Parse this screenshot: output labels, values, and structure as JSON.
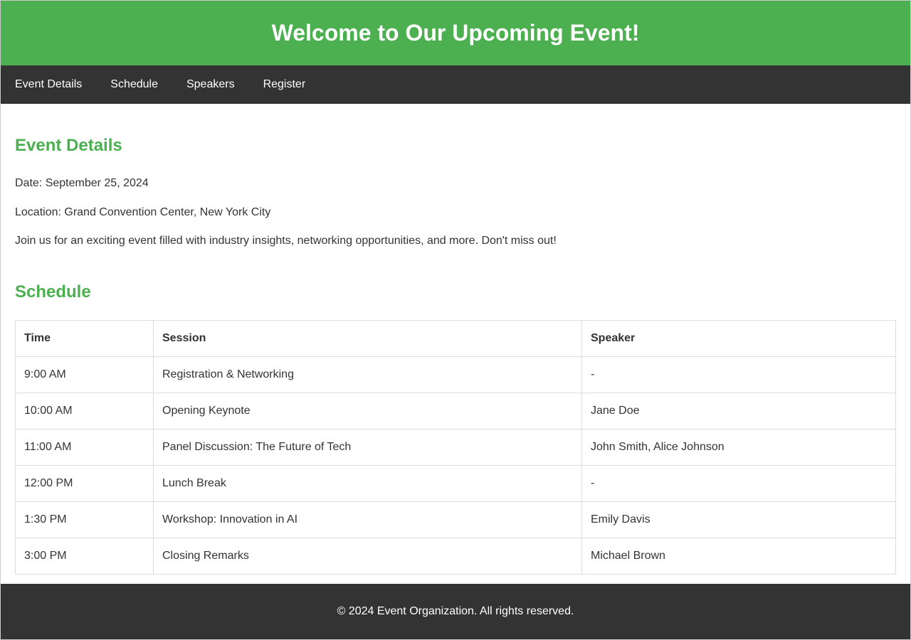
{
  "header": {
    "title": "Welcome to Our Upcoming Event!"
  },
  "nav": {
    "items": [
      {
        "label": "Event Details"
      },
      {
        "label": "Schedule"
      },
      {
        "label": "Speakers"
      },
      {
        "label": "Register"
      }
    ]
  },
  "event_details": {
    "title": "Event Details",
    "date": "Date: September 25, 2024",
    "location": "Location: Grand Convention Center, New York City",
    "description": "Join us for an exciting event filled with industry insights, networking opportunities, and more. Don't miss out!"
  },
  "schedule": {
    "title": "Schedule",
    "columns": [
      "Time",
      "Session",
      "Speaker"
    ],
    "rows": [
      [
        "9:00 AM",
        "Registration & Networking",
        "-"
      ],
      [
        "10:00 AM",
        "Opening Keynote",
        "Jane Doe"
      ],
      [
        "11:00 AM",
        "Panel Discussion: The Future of Tech",
        "John Smith, Alice Johnson"
      ],
      [
        "12:00 PM",
        "Lunch Break",
        "-"
      ],
      [
        "1:30 PM",
        "Workshop: Innovation in AI",
        "Emily Davis"
      ],
      [
        "3:00 PM",
        "Closing Remarks",
        "Michael Brown"
      ]
    ]
  },
  "footer": {
    "text": "© 2024 Event Organization. All rights reserved."
  },
  "colors": {
    "brand_green": "#4caf50",
    "dark": "#333333"
  }
}
